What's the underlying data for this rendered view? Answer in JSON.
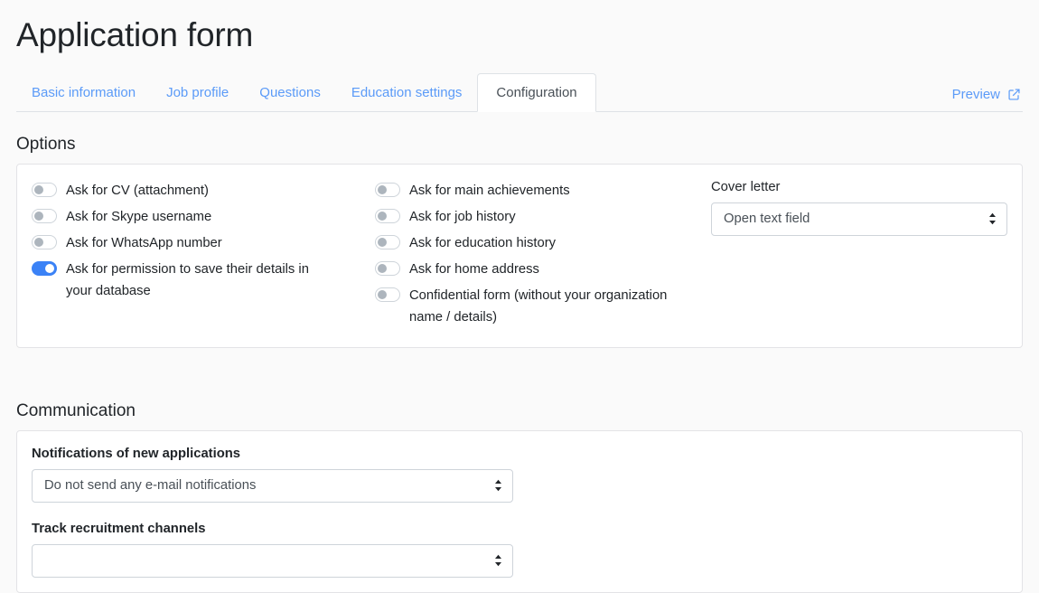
{
  "header": {
    "title": "Application form",
    "preview": {
      "label": "Preview",
      "icon": "external-link-icon"
    }
  },
  "tabs": [
    {
      "label": "Basic information",
      "active": false
    },
    {
      "label": "Job profile",
      "active": false
    },
    {
      "label": "Questions",
      "active": false
    },
    {
      "label": "Education settings",
      "active": false
    },
    {
      "label": "Configuration",
      "active": true
    }
  ],
  "options": {
    "heading": "Options",
    "column_left": [
      {
        "label": "Ask for CV (attachment)",
        "on": false
      },
      {
        "label": "Ask for Skype username",
        "on": false
      },
      {
        "label": "Ask for WhatsApp number",
        "on": false
      },
      {
        "label": "Ask for permission to save their details in your database",
        "on": true
      }
    ],
    "column_middle": [
      {
        "label": "Ask for main achievements",
        "on": false
      },
      {
        "label": "Ask for job history",
        "on": false
      },
      {
        "label": "Ask for education history",
        "on": false
      },
      {
        "label": "Ask for home address",
        "on": false
      },
      {
        "label": "Confidential form (without your organization name / details)",
        "on": false
      }
    ],
    "cover_letter": {
      "label": "Cover letter",
      "value": "Open text field"
    }
  },
  "communication": {
    "heading": "Communication",
    "notifications": {
      "label": "Notifications of new applications",
      "value": "Do not send any e-mail notifications"
    },
    "tracking": {
      "label": "Track recruitment channels",
      "value": ""
    }
  },
  "colors": {
    "accent_blue": "#3b82f6",
    "link_blue": "#5b9bf8",
    "text_dark": "#212529",
    "muted_text": "#495057",
    "border": "#dee2e6",
    "page_bg": "#fafafa",
    "card_bg": "#ffffff"
  }
}
